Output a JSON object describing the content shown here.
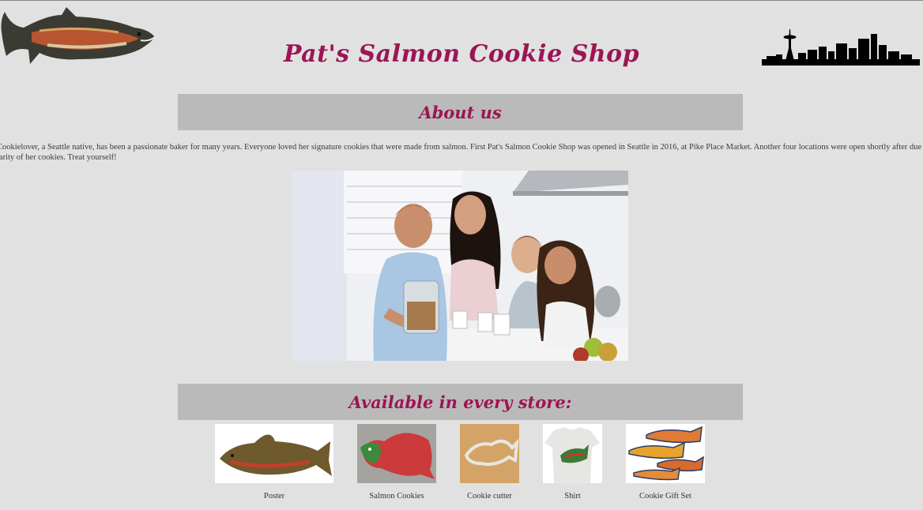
{
  "header": {
    "title": "Pat's Salmon Cookie Shop",
    "logo_icon": "salmon-icon",
    "skyline_icon": "seattle-skyline-icon"
  },
  "about": {
    "heading": "About us",
    "text_line1": "Cookielover, a Seattle native, has been a passionate baker for many years. Everyone loved her signature cookies that were made from salmon. First Pat's Salmon Cookie Shop was opened in Seattle in 2016, at Pike Place Market. Another four locations were open shortly after due to incredible",
    "text_line2": "larity of her cookies. Treat yourself!"
  },
  "products": {
    "heading": "Available in every store:",
    "items": [
      {
        "label": "Poster"
      },
      {
        "label": "Salmon Cookies"
      },
      {
        "label": "Cookie cutter"
      },
      {
        "label": "Shirt"
      },
      {
        "label": "Cookie Gift Set"
      }
    ]
  },
  "colors": {
    "background": "#e1e1e1",
    "banner": "#bababa",
    "accent": "#9c1555"
  }
}
